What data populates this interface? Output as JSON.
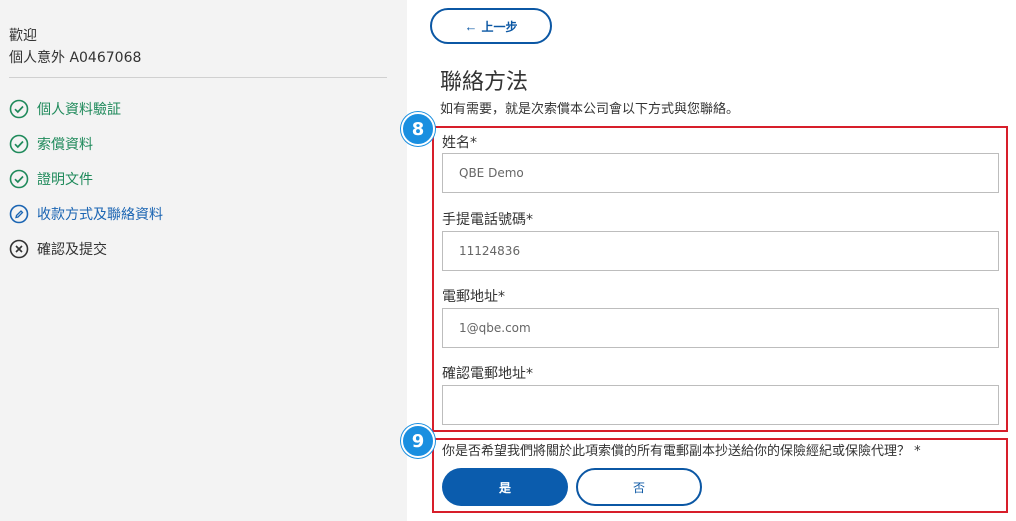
{
  "sidebar": {
    "welcome": "歡迎",
    "policy": "個人意外 A0467068",
    "steps": [
      {
        "label": "個人資料驗証",
        "status": "done"
      },
      {
        "label": "索償資料",
        "status": "done"
      },
      {
        "label": "證明文件",
        "status": "done"
      },
      {
        "label": "收款方式及聯絡資料",
        "status": "current"
      },
      {
        "label": "確認及提交",
        "status": "pending"
      }
    ]
  },
  "main": {
    "back_label": "上一步",
    "title": "聯絡方法",
    "description": "如有需要，就是次索償本公司會以下方式與您聯絡。",
    "fields": {
      "name": {
        "label": "姓名*",
        "value": "QBE Demo"
      },
      "mobile": {
        "label": "手提電話號碼*",
        "value": "11124836"
      },
      "email": {
        "label": "電郵地址*",
        "value": "1@qbe.com"
      },
      "confirm_email": {
        "label": "確認電郵地址*",
        "value": ""
      }
    },
    "question": "你是否希望我們將關於此項索償的所有電郵副本抄送給你的保險經紀或保險代理？ *",
    "yes_label": "是",
    "no_label": "否"
  },
  "annotations": {
    "badge_8": "8",
    "badge_9": "9"
  },
  "colors": {
    "done": "#1f8a5b",
    "current": "#1b65b3",
    "primary": "#0b5cad",
    "highlight_box": "#d71e2a",
    "badge": "#1a8fe0"
  }
}
